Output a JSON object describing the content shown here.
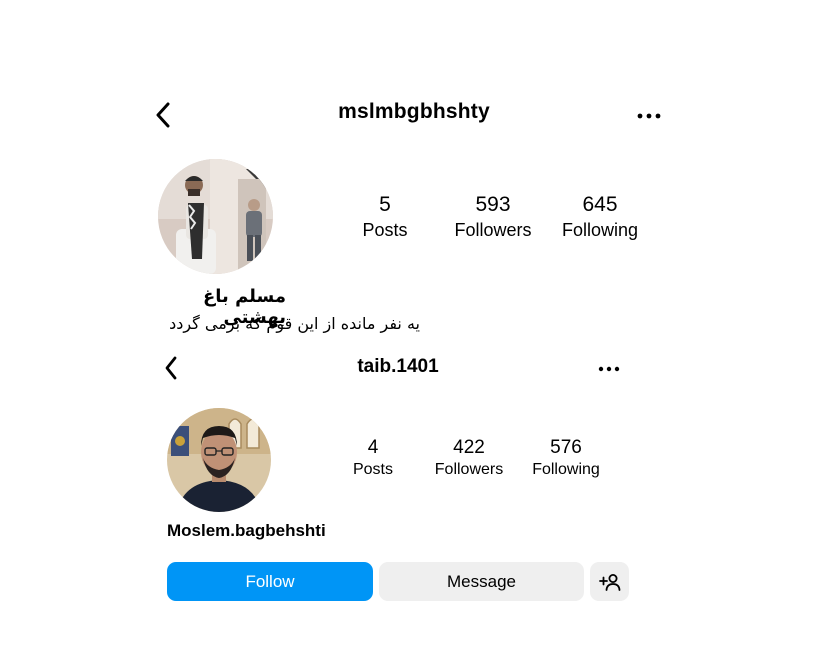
{
  "profile1": {
    "username": "mslmbgbhshty",
    "stats": {
      "posts_count": "5",
      "posts_label": "Posts",
      "followers_count": "593",
      "followers_label": "Followers",
      "following_count": "645",
      "following_label": "Following"
    },
    "display_name": "مسلم باغ بهشتی",
    "bio": "یه نفر مانده از این قوم که برمی گردد"
  },
  "profile2": {
    "username": "taib.1401",
    "stats": {
      "posts_count": "4",
      "posts_label": "Posts",
      "followers_count": "422",
      "followers_label": "Followers",
      "following_count": "576",
      "following_label": "Following"
    },
    "display_name": "Moslem.bagbehshti",
    "buttons": {
      "follow": "Follow",
      "message": "Message"
    }
  },
  "colors": {
    "follow_button": "#0095f6",
    "secondary_button": "#efefef"
  },
  "icons": [
    "back-chevron-icon",
    "more-options-icon",
    "add-person-icon"
  ]
}
